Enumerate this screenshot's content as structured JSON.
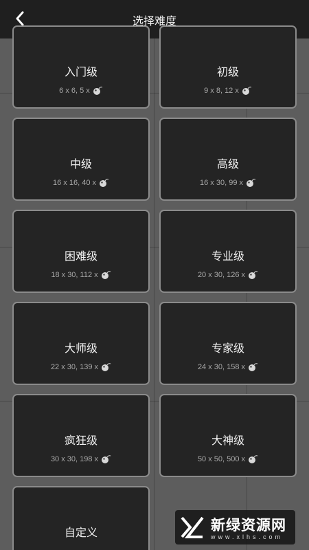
{
  "header": {
    "title": "选择难度",
    "back_icon": "chevron-left-icon"
  },
  "levels": [
    {
      "name": "入门级",
      "spec": "6 x 6,  5 x"
    },
    {
      "name": "初级",
      "spec": "9 x 8,  12 x"
    },
    {
      "name": "中级",
      "spec": "16 x 16,  40 x"
    },
    {
      "name": "高级",
      "spec": "16 x 30,  99 x"
    },
    {
      "name": "困难级",
      "spec": "18 x 30,  112 x"
    },
    {
      "name": "专业级",
      "spec": "20 x 30,  126 x"
    },
    {
      "name": "大师级",
      "spec": "22 x 30,  139 x"
    },
    {
      "name": "专家级",
      "spec": "24 x 30,  158 x"
    },
    {
      "name": "疯狂级",
      "spec": "30 x 30,  198 x"
    },
    {
      "name": "大神级",
      "spec": "50 x 50,  500 x"
    },
    {
      "name": "自定义",
      "spec": ""
    }
  ],
  "watermark": {
    "main": "新绿资源网",
    "sub": "www.xlhs.com"
  },
  "colors": {
    "background": "#5d5d5d",
    "card": "#242424",
    "card_border": "#8b8b8b",
    "header": "#1f1f1f"
  }
}
